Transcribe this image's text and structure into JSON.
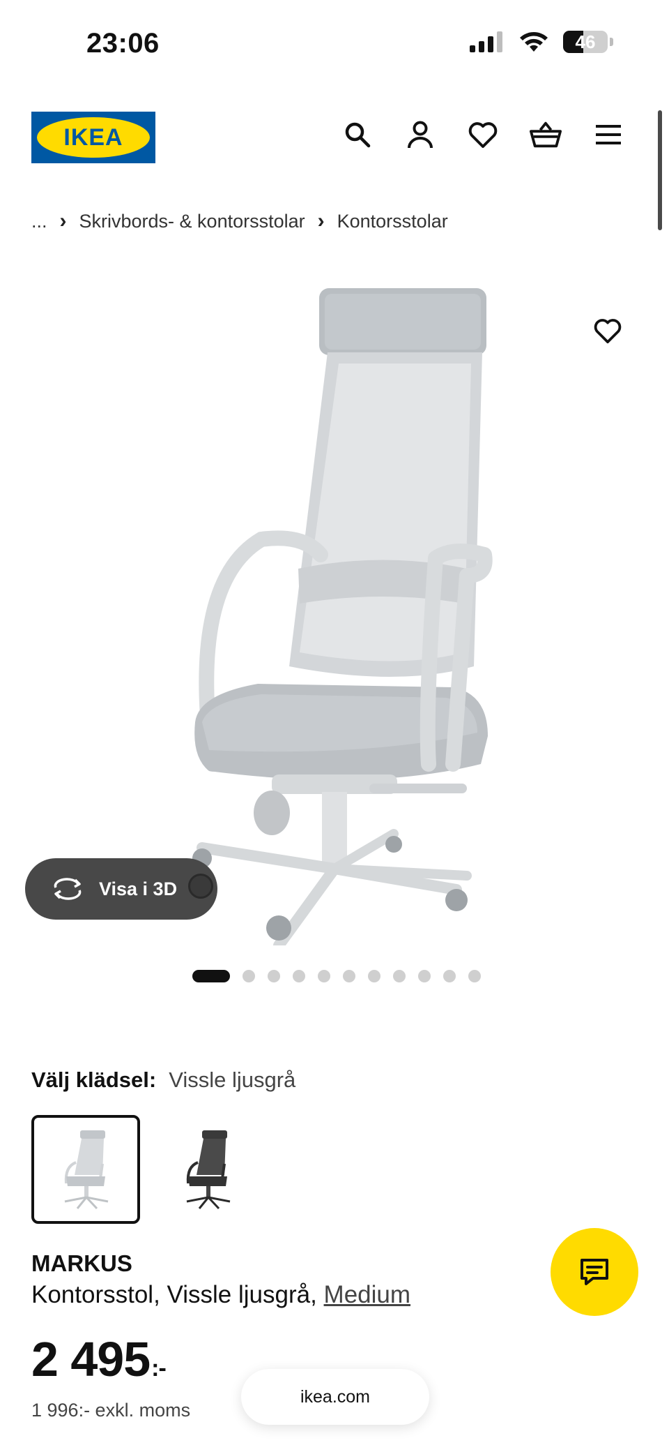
{
  "status_bar": {
    "time": "23:06",
    "battery_level": "46",
    "battery_fraction": 0.46,
    "icons": [
      "signal-icon",
      "wifi-icon",
      "battery-icon"
    ]
  },
  "header": {
    "logo_text": "IKEA",
    "brand_colors": {
      "blue": "#0058a3",
      "yellow": "#ffdb00"
    },
    "icons": [
      "search-icon",
      "user-icon",
      "heart-icon",
      "basket-icon",
      "menu-icon"
    ]
  },
  "breadcrumb": {
    "items": [
      "...",
      "Skrivbords- & kontorsstolar",
      "Kontorsstolar"
    ]
  },
  "gallery": {
    "view_3d_label": "Visa i 3D",
    "page_count": 12,
    "active_page": 1
  },
  "variant": {
    "label": "Välj klädsel:",
    "selected_value": "Vissle ljusgrå",
    "options": [
      "Vissle ljusgrå",
      "dark-grey"
    ]
  },
  "product": {
    "name": "MARKUS",
    "description_prefix": "Kontorsstol, Vissle ljusgrå, ",
    "size_link": "Medium",
    "price": "2 495",
    "price_suffix": ":-",
    "price_excl_vat": "1 996:- exkl. moms"
  },
  "browser": {
    "url": "ikea.com"
  }
}
